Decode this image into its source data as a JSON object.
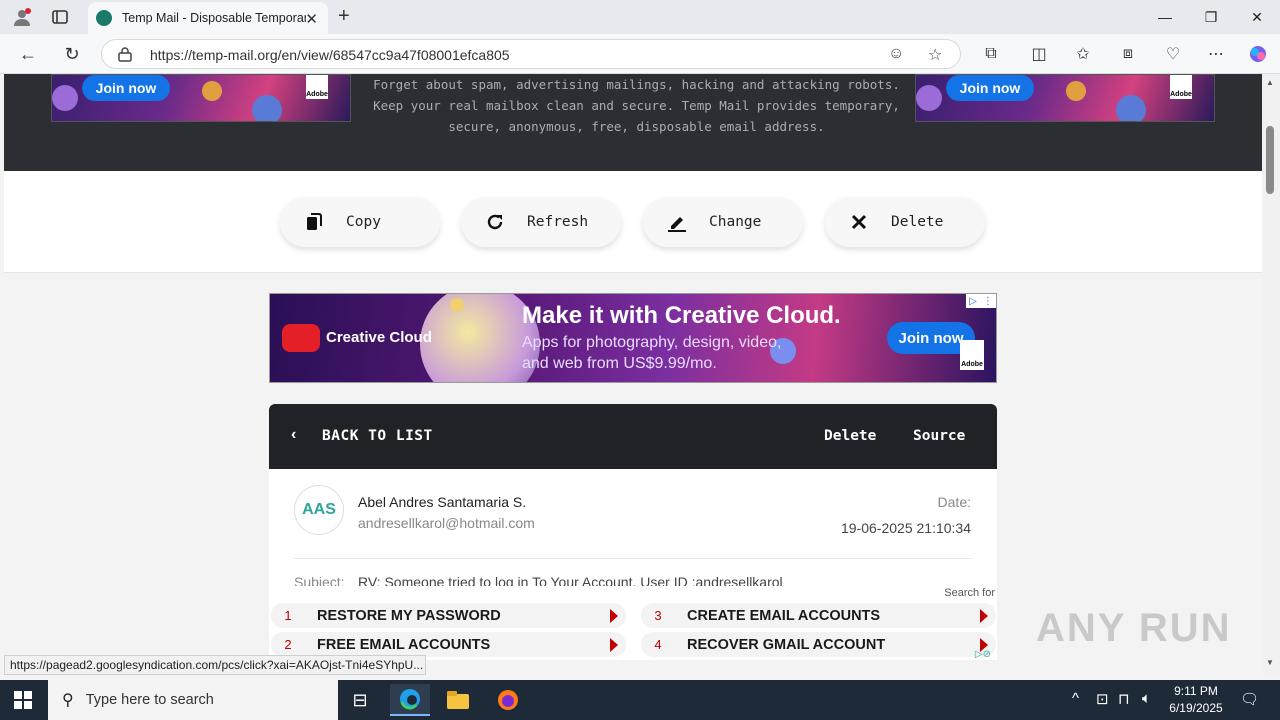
{
  "browser": {
    "tab_title": "Temp Mail - Disposable Temporar",
    "url": "https://temp-mail.org/en/view/68547cc9a47f08001efca805"
  },
  "hero": {
    "text": "Forget about spam, advertising mailings, hacking and attacking robots. Keep your real mailbox clean and secure. Temp Mail provides temporary, secure, anonymous, free, disposable email address.",
    "left_ad": {
      "join": "Join now",
      "brand": "Adobe"
    },
    "right_ad": {
      "join": "Join now",
      "brand": "Adobe"
    }
  },
  "actions": [
    {
      "label": "Copy",
      "icon": "copy-icon"
    },
    {
      "label": "Refresh",
      "icon": "refresh-icon"
    },
    {
      "label": "Change",
      "icon": "edit-icon"
    },
    {
      "label": "Delete",
      "icon": "close-icon"
    }
  ],
  "banner_ad": {
    "brand": "Creative Cloud",
    "headline": "Make it with Creative Cloud.",
    "subline": "Apps for photography, design, video, and web from US$9.99/mo.",
    "join": "Join now",
    "adobe": "Adobe"
  },
  "mail": {
    "back_label": "BACK TO LIST",
    "delete_label": "Delete",
    "source_label": "Source",
    "avatar_initials": "AAS",
    "sender_name": "Abel Andres Santamaria S.",
    "sender_email": "andresellkarol@hotmail.com",
    "date_label": "Date:",
    "date_value": "19-06-2025 21:10:34",
    "subject_label": "Subject:",
    "subject_value": "RV: Someone tried to log in To Your Account. User ID :andresellkarol"
  },
  "search_ads": {
    "header": "Search for",
    "items": [
      {
        "num": "1",
        "label": "RESTORE MY PASSWORD"
      },
      {
        "num": "3",
        "label": "CREATE EMAIL ACCOUNTS"
      },
      {
        "num": "2",
        "label": "FREE EMAIL ACCOUNTS"
      },
      {
        "num": "4",
        "label": "RECOVER GMAIL ACCOUNT"
      }
    ]
  },
  "status_url": "https://pagead2.googlesyndication.com/pcs/click?xai=AKAOjst-Tni4eSYhpU...",
  "watermark": "ANY RUN",
  "taskbar": {
    "search_placeholder": "Type here to search",
    "time": "9:11 PM",
    "date": "6/19/2025"
  }
}
